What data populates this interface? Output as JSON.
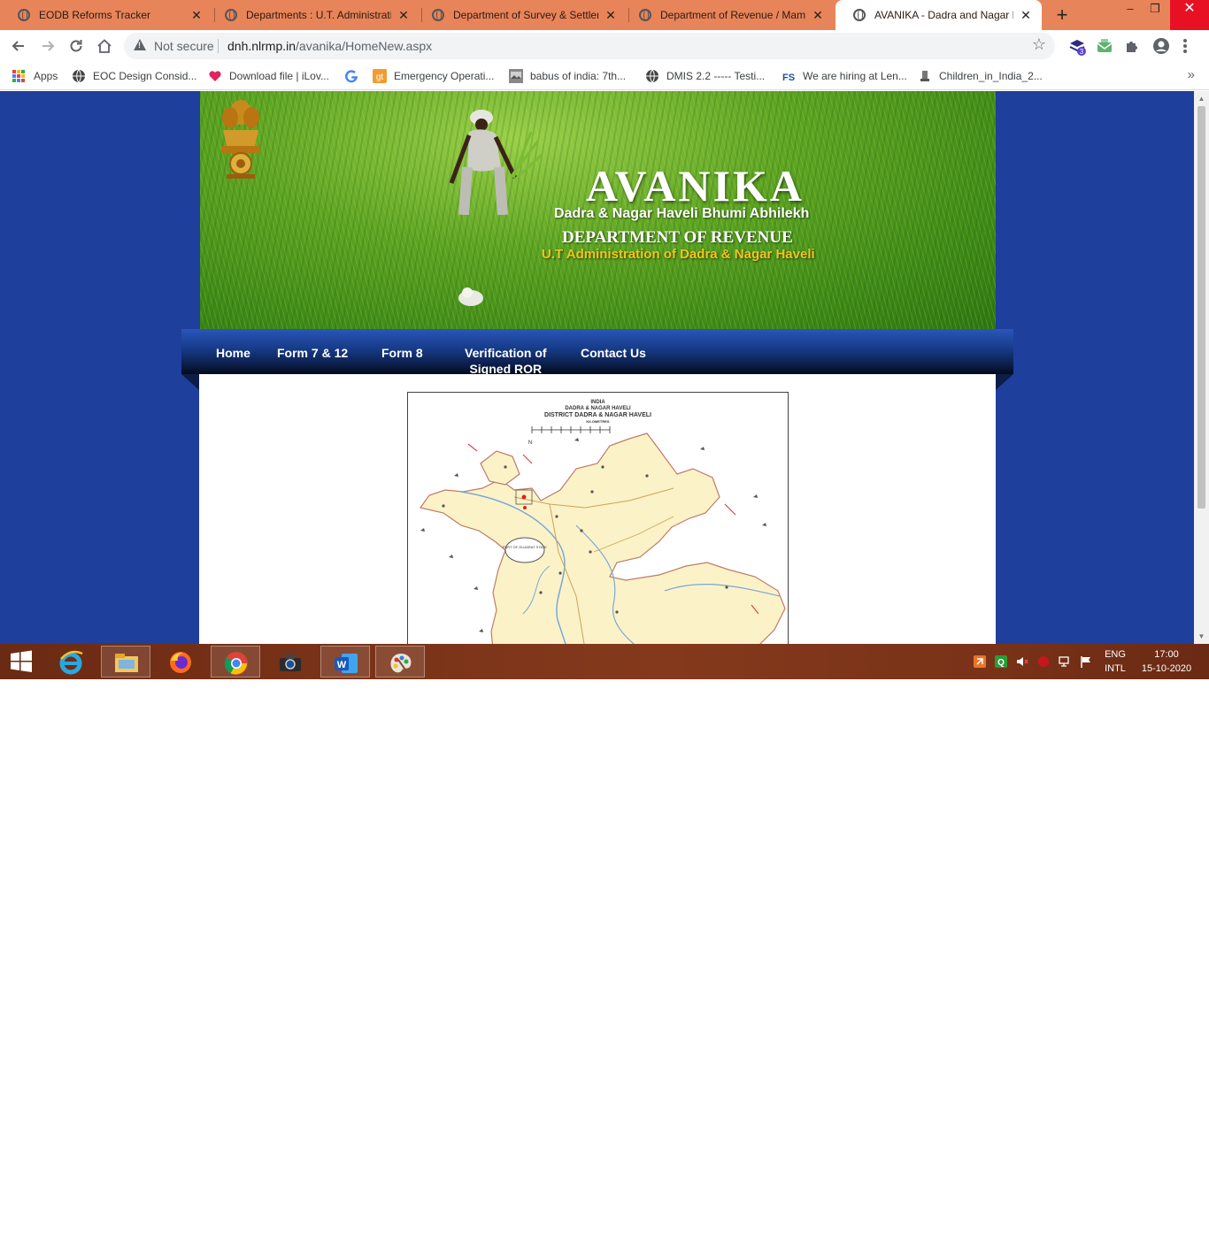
{
  "browser": {
    "tabs": [
      {
        "title": "EODB Reforms Tracker",
        "active": false
      },
      {
        "title": "Departments : U.T. Administration",
        "active": false
      },
      {
        "title": "Department of Survey & Settlement",
        "active": false
      },
      {
        "title": "Department of Revenue / Mamlatdar",
        "active": false
      },
      {
        "title": "AVANIKA - Dadra and Nagar Haveli",
        "active": true
      }
    ],
    "tab_close_glyph": "✕",
    "new_tab_glyph": "+",
    "window_controls": {
      "minimize": "–",
      "restore": "❐",
      "close": "✕"
    },
    "address": {
      "security_label": "Not secure",
      "host": "dnh.nlrmp.in",
      "path": "/avanika/HomeNew.aspx"
    },
    "extension_badge": "3",
    "bookmarks": [
      {
        "label": "Apps",
        "icon": "apps-grid-icon"
      },
      {
        "label": "EOC Design Consid...",
        "icon": "globe-icon"
      },
      {
        "label": "Download file | iLov...",
        "icon": "heart-icon"
      },
      {
        "label": "",
        "icon": "google-icon"
      },
      {
        "label": "Emergency Operati...",
        "icon": "gt-icon"
      },
      {
        "label": "babus of india: 7th...",
        "icon": "image-icon"
      },
      {
        "label": "DMIS 2.2 ----- Testi...",
        "icon": "globe-icon"
      },
      {
        "label": "We are hiring at Len...",
        "icon": "fs-icon"
      },
      {
        "label": "Children_in_India_2...",
        "icon": "emblem-icon"
      }
    ],
    "bookmarks_more": "»"
  },
  "page": {
    "banner": {
      "title": "AVANIKA",
      "subtitle1": "Dadra & Nagar Haveli Bhumi Abhilekh",
      "subtitle2": "DEPARTMENT OF REVENUE",
      "subtitle3": "U.T Administration of Dadra & Nagar Haveli"
    },
    "nav": [
      {
        "label": "Home"
      },
      {
        "label": "Form 7 & 12"
      },
      {
        "label": "Form 8"
      },
      {
        "label": "Verification of Signed ROR",
        "line1": "Verification of",
        "line2": "Signed ROR"
      },
      {
        "label": "Contact Us"
      }
    ],
    "map": {
      "line1": "INDIA",
      "line2": "DADRA & NAGAR HAVELI",
      "line3": "DISTRICT DADRA & NAGAR HAVELI",
      "line4": "KILOMETRES",
      "inset": "PART OF GUJARAT STATE",
      "north": "N"
    }
  },
  "taskbar": {
    "apps": [
      "windows-start",
      "internet-explorer",
      "file-explorer",
      "firefox",
      "chrome",
      "camera-app",
      "word",
      "paint"
    ],
    "language": "ENG",
    "keyboard": "INTL",
    "time": "17:00",
    "date": "15-10-2020"
  },
  "colors": {
    "tabstrip": "#e8845a",
    "page_background": "#1e3f9c",
    "nav_gradient_top": "#2a56b8",
    "nav_gradient_bottom": "#030a1c",
    "banner_gold_text": "#f3c51c",
    "map_land": "#fbf3c7",
    "taskbar": "#7a3318"
  }
}
